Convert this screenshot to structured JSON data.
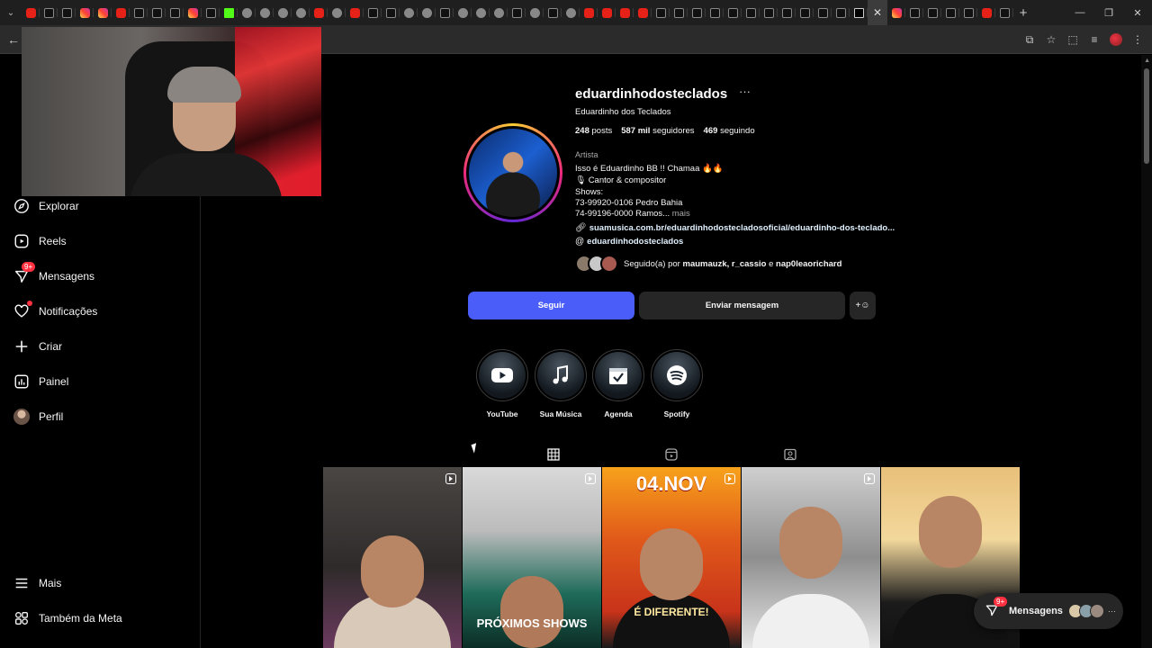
{
  "browser": {
    "tabs": [
      {
        "icon": "youtube"
      },
      {
        "icon": "tiktok"
      },
      {
        "icon": "tiktok"
      },
      {
        "icon": "instagram"
      },
      {
        "icon": "instagram"
      },
      {
        "icon": "youtube"
      },
      {
        "icon": "tiktok"
      },
      {
        "icon": "tiktok"
      },
      {
        "icon": "tiktok"
      },
      {
        "icon": "instagram"
      },
      {
        "icon": "tiktok"
      },
      {
        "icon": "kick"
      },
      {
        "icon": "chrome"
      },
      {
        "icon": "chrome"
      },
      {
        "icon": "chrome"
      },
      {
        "icon": "chrome"
      },
      {
        "icon": "youtube"
      },
      {
        "icon": "chrome"
      },
      {
        "icon": "youtube"
      },
      {
        "icon": "tiktok"
      },
      {
        "icon": "tiktok"
      },
      {
        "icon": "chrome"
      },
      {
        "icon": "chrome"
      },
      {
        "icon": "tiktok"
      },
      {
        "icon": "chrome"
      },
      {
        "icon": "chrome"
      },
      {
        "icon": "chrome"
      },
      {
        "icon": "tiktok"
      },
      {
        "icon": "chrome"
      },
      {
        "icon": "tiktok"
      },
      {
        "icon": "chrome"
      },
      {
        "icon": "youtube"
      },
      {
        "icon": "youtube"
      },
      {
        "icon": "youtube"
      },
      {
        "icon": "youtube"
      },
      {
        "icon": "tiktok"
      },
      {
        "icon": "tiktok"
      },
      {
        "icon": "tiktok"
      },
      {
        "icon": "tiktok"
      },
      {
        "icon": "tiktok"
      },
      {
        "icon": "tiktok"
      },
      {
        "icon": "tiktok"
      },
      {
        "icon": "tiktok"
      },
      {
        "icon": "tiktok"
      },
      {
        "icon": "tiktok"
      },
      {
        "icon": "tiktok"
      },
      {
        "icon": "x"
      }
    ],
    "active_tab": {
      "icon": "close-icon",
      "close_glyph": "✕"
    },
    "after_tabs": [
      {
        "icon": "instagram"
      },
      {
        "icon": "tiktok"
      },
      {
        "icon": "tiktok"
      },
      {
        "icon": "tiktok"
      },
      {
        "icon": "tiktok"
      },
      {
        "icon": "youtube"
      },
      {
        "icon": "tiktok"
      }
    ],
    "new_tab": "+",
    "window_controls": {
      "minimize": "—",
      "restore": "❐",
      "close": "✕"
    },
    "toolbar": {
      "back": "←",
      "icons": [
        "install-icon",
        "star-icon",
        "extensions-icon",
        "media-icon"
      ]
    }
  },
  "sidebar": {
    "items": [
      {
        "name": "explorar",
        "label": "Explorar",
        "icon": "compass-icon"
      },
      {
        "name": "reels",
        "label": "Reels",
        "icon": "reels-icon"
      },
      {
        "name": "mensagens",
        "label": "Mensagens",
        "icon": "messenger-icon",
        "badge": "9+"
      },
      {
        "name": "notificacoes",
        "label": "Notificações",
        "icon": "heart-icon"
      },
      {
        "name": "criar",
        "label": "Criar",
        "icon": "plus-icon"
      },
      {
        "name": "painel",
        "label": "Painel",
        "icon": "dashboard-icon"
      },
      {
        "name": "perfil",
        "label": "Perfil",
        "icon": "avatar"
      }
    ],
    "bottom": [
      {
        "name": "mais",
        "label": "Mais",
        "icon": "menu-icon"
      },
      {
        "name": "meta",
        "label": "Também da Meta",
        "icon": "meta-apps-icon"
      }
    ]
  },
  "profile": {
    "username": "eduardinhodosteclados",
    "more_glyph": "···",
    "display_name": "Eduardinho dos Teclados",
    "stats": {
      "posts_count": "248",
      "posts_label": "posts",
      "followers_count": "587 mil",
      "followers_label": "seguidores",
      "following_count": "469",
      "following_label": "seguindo"
    },
    "category": "Artista",
    "bio": [
      "Isso é Eduardinho BB !! Chamaa 🔥🔥",
      "🎙 Cantor & compositor",
      "Shows:",
      "73-99920-0106 Pedro Bahia",
      "74-99196-0000 Ramos..."
    ],
    "bio_more": "mais",
    "link": "suamusica.com.br/eduardinhodostecladosoficial/eduardinho-dos-teclado...",
    "threads": "eduardinhodosteclados",
    "followed_by_prefix": "Seguido(a) por",
    "followed_by_names": "maumauzk, r_cassio",
    "followed_by_and": "e",
    "followed_by_last": "nap0leaorichard"
  },
  "actions": {
    "follow": "Seguir",
    "message": "Enviar mensagem",
    "suggest_glyph": "+"
  },
  "highlights": [
    {
      "label": "YouTube",
      "icon": "youtube-icon"
    },
    {
      "label": "Sua Música",
      "icon": "music-note-icon"
    },
    {
      "label": "Agenda",
      "icon": "calendar-check-icon"
    },
    {
      "label": "Spotify",
      "icon": "spotify-icon"
    }
  ],
  "profile_tabs": [
    {
      "name": "posts",
      "icon": "grid-icon",
      "active": true
    },
    {
      "name": "reels",
      "icon": "reels-icon",
      "active": false
    },
    {
      "name": "tagged",
      "icon": "tagged-icon",
      "active": false
    }
  ],
  "posts": [
    {
      "type": "reel"
    },
    {
      "type": "reel",
      "text": "PRÓXIMOS SHOWS"
    },
    {
      "type": "reel",
      "text_top": "04.NOV",
      "text_bottom": "É DIFERENTE!"
    },
    {
      "type": "reel"
    },
    {
      "type": "image"
    }
  ],
  "messages_pill": {
    "label": "Mensagens",
    "badge": "9+",
    "more": "···"
  },
  "colors": {
    "follow_button": "#4a5df9",
    "secondary_button": "#262626",
    "badge": "#ff3040",
    "background": "#000000"
  }
}
